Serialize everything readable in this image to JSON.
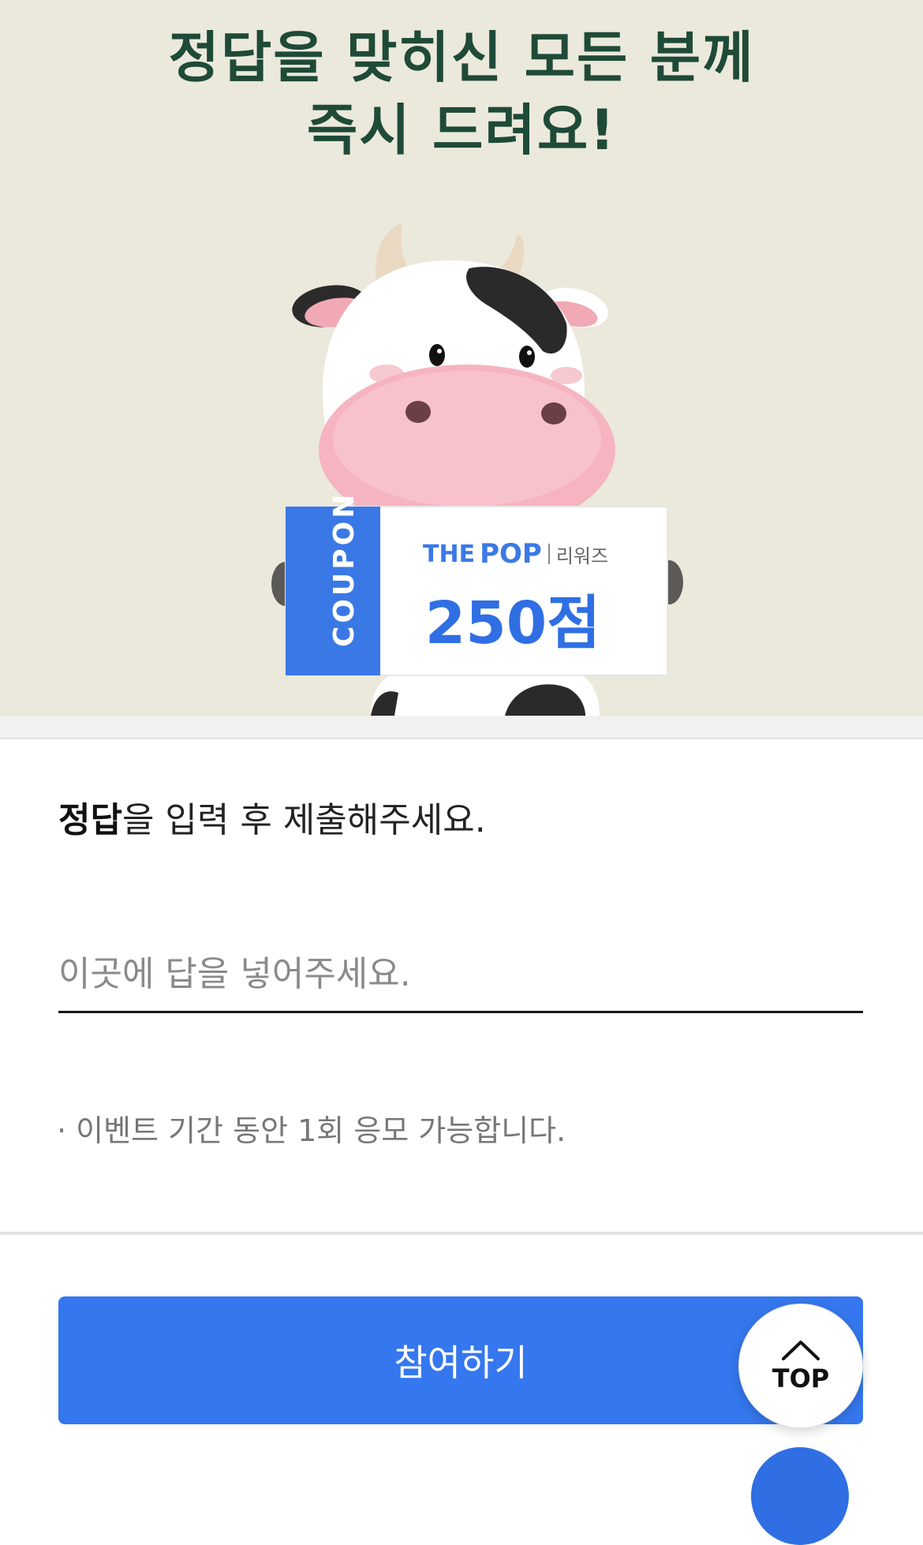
{
  "hero": {
    "title_line1": "정답을 맞히신 모든 분께",
    "title_line2": "즉시 드려요!",
    "coupon": {
      "label": "COUPON",
      "brand_prefix": "THE",
      "brand_logo": "POP",
      "brand_sub": "리워즈",
      "amount": "250점"
    }
  },
  "form": {
    "instruction_bold": "정답",
    "instruction_rest": "을 입력 후 제출해주세요.",
    "answer_placeholder": "이곳에 답을 넣어주세요.",
    "answer_value": "",
    "notice": "· 이벤트 기간 동안 1회 응모 가능합니다."
  },
  "actions": {
    "submit_label": "참여하기",
    "top_label": "TOP"
  },
  "colors": {
    "hero_bg": "#ebe9db",
    "title": "#1f4a38",
    "accent": "#3577ee"
  },
  "icons": {
    "top": "chevron-up-icon",
    "illustration": "cow-mascot"
  }
}
